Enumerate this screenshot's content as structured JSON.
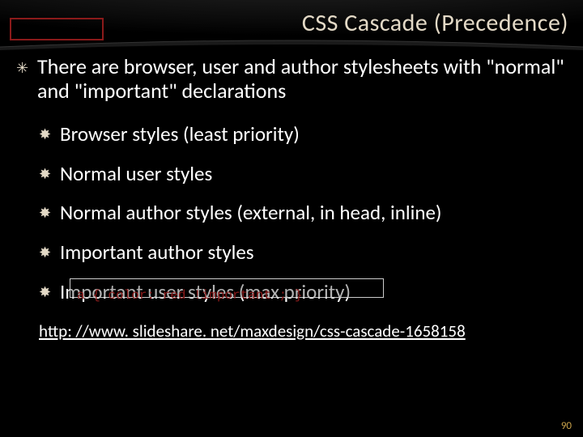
{
  "title": "CSS Cascade (Precedence)",
  "main_point": "There are browser, user and author stylesheets with \"normal\" and \"important\" declarations",
  "items": [
    "Browser styles (least priority)",
    "Normal user styles",
    "Normal author styles (external, in head, inline)",
    "Important author styles",
    "Important user styles (max priority)"
  ],
  "code_sample": "a { color: red !important ; }",
  "link_text": "http: //www. slideshare. net/maxdesign/css-cascade-1658158",
  "page_number": "90",
  "bullets": {
    "star_open": "✳",
    "star_filled": "✸"
  }
}
